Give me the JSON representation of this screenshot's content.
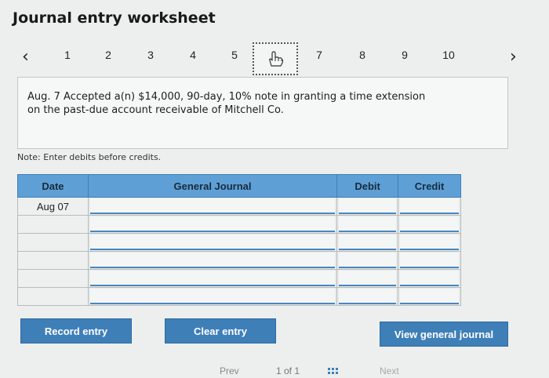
{
  "title": "Journal entry worksheet",
  "nav": {
    "prev_icon": "chevron-left-icon",
    "next_icon": "chevron-right-icon",
    "steps": [
      "1",
      "2",
      "3",
      "4",
      "5",
      "6",
      "7",
      "8",
      "9",
      "10"
    ],
    "current_step": "6",
    "current_icon": "hand-pointer-icon"
  },
  "question": {
    "line1": "Aug. 7 Accepted a(n) $14,000, 90-day, 10% note in granting a time extension",
    "line2": "on the past-due account receivable of Mitchell Co."
  },
  "note": "Note: Enter debits before credits.",
  "journal": {
    "headers": {
      "date": "Date",
      "general_journal": "General Journal",
      "debit": "Debit",
      "credit": "Credit"
    },
    "rows": [
      {
        "date": "Aug 07",
        "account": "",
        "debit": "",
        "credit": ""
      },
      {
        "date": "",
        "account": "",
        "debit": "",
        "credit": ""
      },
      {
        "date": "",
        "account": "",
        "debit": "",
        "credit": ""
      },
      {
        "date": "",
        "account": "",
        "debit": "",
        "credit": ""
      },
      {
        "date": "",
        "account": "",
        "debit": "",
        "credit": ""
      },
      {
        "date": "",
        "account": "",
        "debit": "",
        "credit": ""
      }
    ]
  },
  "buttons": {
    "record": "Record entry",
    "clear": "Clear entry",
    "view": "View general journal"
  },
  "pager": {
    "prev": "Prev",
    "page": "1 of 1",
    "next": "Next",
    "grid_icon": "grid-icon"
  }
}
